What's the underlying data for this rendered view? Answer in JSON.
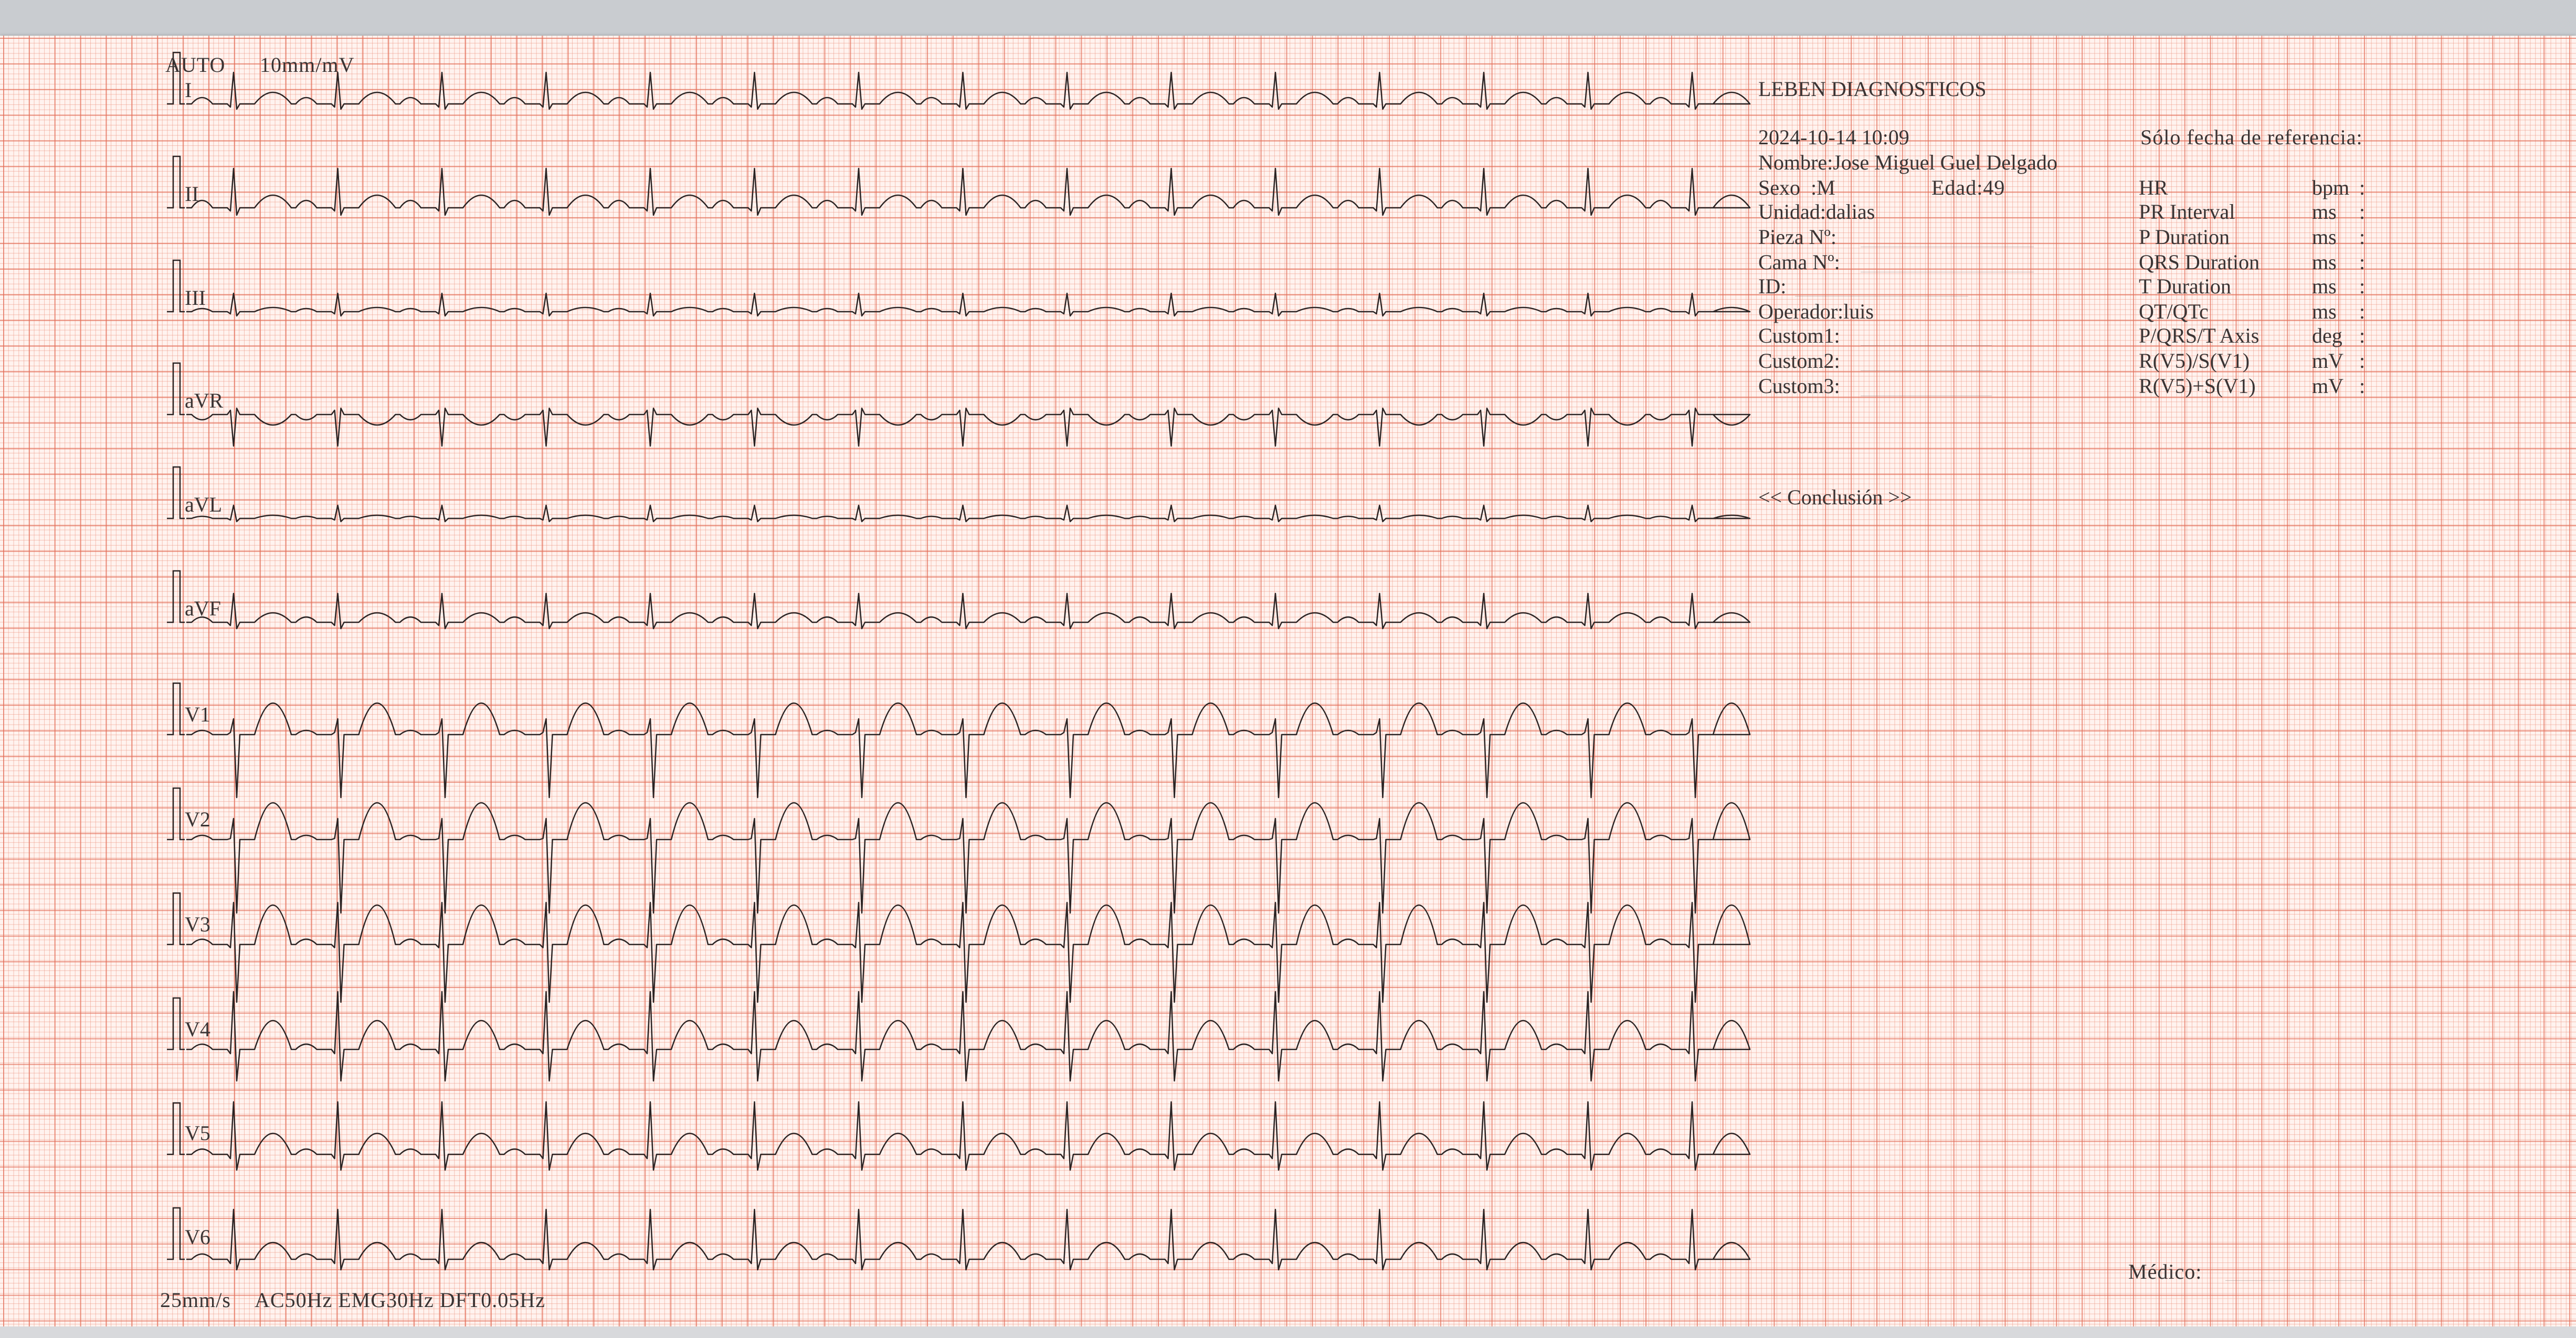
{
  "header": {
    "mode": "AUTO",
    "gain": "10mm/mV"
  },
  "footer": {
    "speed": "25mm/s",
    "filters": "AC50Hz EMG30Hz DFT0.05Hz"
  },
  "leads": [
    "I",
    "II",
    "III",
    "aVR",
    "aVL",
    "aVF",
    "V1",
    "V2",
    "V3",
    "V4",
    "V5",
    "V6"
  ],
  "report": {
    "clinic": "LEBEN DIAGNOSTICOS",
    "datetime": "2024-10-14 10:09",
    "reference_note": "Sólo fecha de referencia:",
    "patient": {
      "name_label": "Nombre:",
      "name": "Jose Miguel Guel Delgado",
      "sex_label": "Sexo  :",
      "sex": "M",
      "age_label": "Edad:",
      "age": "49",
      "unit_label": "Unidad:",
      "unit": "dalias",
      "room_label": "Pieza Nº:",
      "bed_label": "Cama Nº:",
      "id_label": "ID:",
      "operator_label": "Operador:",
      "operator": "luis",
      "custom1_label": "Custom1:",
      "custom2_label": "Custom2:",
      "custom3_label": "Custom3:"
    },
    "measurements": [
      {
        "name": "HR",
        "unit": "bpm",
        "sep": ":"
      },
      {
        "name": "PR Interval",
        "unit": "ms",
        "sep": ":"
      },
      {
        "name": "P Duration",
        "unit": "ms",
        "sep": ":"
      },
      {
        "name": "QRS Duration",
        "unit": "ms",
        "sep": ":"
      },
      {
        "name": "T Duration",
        "unit": "ms",
        "sep": ":"
      },
      {
        "name": "QT/QTc",
        "unit": "ms",
        "sep": ":"
      },
      {
        "name": "P/QRS/T Axis",
        "unit": "deg",
        "sep": ":"
      },
      {
        "name": "R(V5)/S(V1)",
        "unit": "mV",
        "sep": ":"
      },
      {
        "name": "R(V5)+S(V1)",
        "unit": "mV",
        "sep": ":"
      }
    ],
    "conclusion": "<< Conclusión >>",
    "physician_label": "Médico:"
  },
  "colors": {
    "paper": "#fff3ef",
    "grid_major": "#e26c56",
    "grid_minor": "#ec927e",
    "trace": "#2b2424",
    "ink": "#3a3434"
  }
}
